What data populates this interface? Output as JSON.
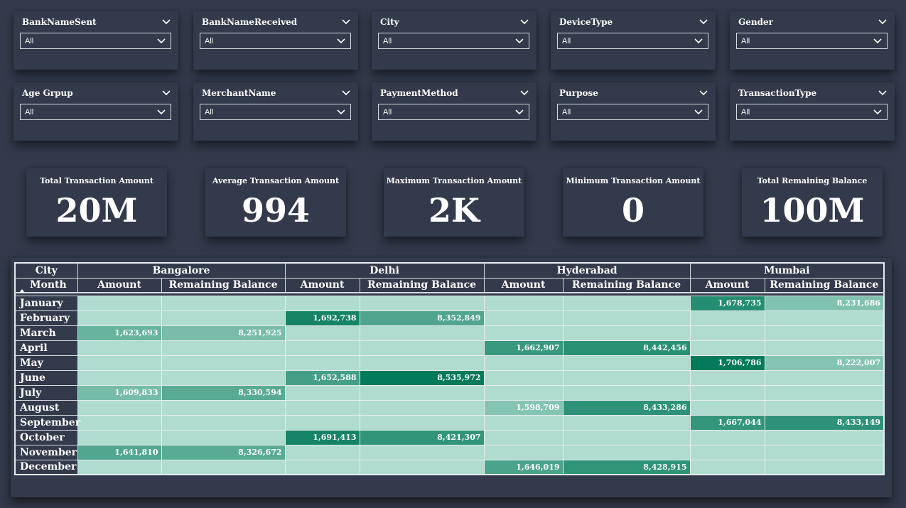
{
  "slicers": [
    {
      "label": "BankNameSent",
      "value": "All"
    },
    {
      "label": "BankNameReceived",
      "value": "All"
    },
    {
      "label": "City",
      "value": "All"
    },
    {
      "label": "DeviceType",
      "value": "All"
    },
    {
      "label": "Gender",
      "value": "All"
    },
    {
      "label": "Age Grpup",
      "value": "All"
    },
    {
      "label": "MerchantName",
      "value": "All"
    },
    {
      "label": "PaymentMethod",
      "value": "All"
    },
    {
      "label": "Purpose",
      "value": "All"
    },
    {
      "label": "TransactionType",
      "value": "All"
    }
  ],
  "kpis": [
    {
      "title": "Total Transaction Amount",
      "value": "20M"
    },
    {
      "title": "Average Transaction Amount",
      "value": "994"
    },
    {
      "title": "Maximum Transaction Amount",
      "value": "2K"
    },
    {
      "title": "Minimum Transaction Amount",
      "value": "0"
    },
    {
      "title": "Total Remaining Balance",
      "value": "100M"
    }
  ],
  "matrix": {
    "row_header": "City",
    "month_header": "Month",
    "cities": [
      "Bangalore",
      "Delhi",
      "Hyderabad",
      "Mumbai"
    ],
    "measures": [
      "Amount",
      "Remaining Balance"
    ],
    "rows": [
      {
        "month": "January",
        "values": [
          "",
          "",
          "",
          "",
          "",
          "",
          "1,678,735",
          "8,231,686"
        ]
      },
      {
        "month": "February",
        "values": [
          "",
          "",
          "1,692,738",
          "8,352,849",
          "",
          "",
          "",
          ""
        ]
      },
      {
        "month": "March",
        "values": [
          "1,623,693",
          "8,251,925",
          "",
          "",
          "",
          "",
          "",
          ""
        ]
      },
      {
        "month": "April",
        "values": [
          "",
          "",
          "",
          "",
          "1,662,907",
          "8,442,456",
          "",
          ""
        ]
      },
      {
        "month": "May",
        "values": [
          "",
          "",
          "",
          "",
          "",
          "",
          "1,706,786",
          "8,222,007"
        ]
      },
      {
        "month": "June",
        "values": [
          "",
          "",
          "1,652,588",
          "8,535,972",
          "",
          "",
          "",
          ""
        ]
      },
      {
        "month": "July",
        "values": [
          "1,609,833",
          "8,330,594",
          "",
          "",
          "",
          "",
          "",
          ""
        ]
      },
      {
        "month": "August",
        "values": [
          "",
          "",
          "",
          "",
          "1,598,709",
          "8,433,286",
          "",
          ""
        ]
      },
      {
        "month": "September",
        "values": [
          "",
          "",
          "",
          "",
          "",
          "",
          "1,667,044",
          "8,433,149"
        ]
      },
      {
        "month": "October",
        "values": [
          "",
          "",
          "1,691,413",
          "8,421,307",
          "",
          "",
          "",
          ""
        ]
      },
      {
        "month": "November",
        "values": [
          "1,641,810",
          "8,326,672",
          "",
          "",
          "",
          "",
          "",
          ""
        ]
      },
      {
        "month": "December",
        "values": [
          "",
          "",
          "",
          "",
          "1,646,019",
          "8,428,915",
          "",
          ""
        ]
      }
    ],
    "colors": {
      "empty": "#b0dccf",
      "low": "#b0dccf",
      "high": "#037a5a",
      "background": "#323a4b"
    }
  }
}
